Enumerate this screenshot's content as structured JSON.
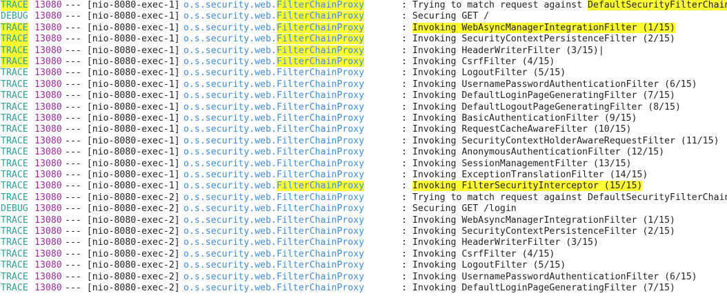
{
  "colors": {
    "trace": "#2aa198",
    "debug": "#2aa198",
    "pid": "#a626a4",
    "logger": "#3b8ede",
    "text": "#222222",
    "highlight": "#ffff33"
  },
  "rows": [
    {
      "level": "TRACE",
      "pid": "13080",
      "thread": "--- [nio-8080-exec-1]",
      "logger_prefix": "o.s.security.web.",
      "logger_class": "FilterChainProxy",
      "msg_prefix": ": ",
      "message": "Trying to match request against ",
      "message_tail": "DefaultSecurityFilterChain [",
      "hl_level": true,
      "hl_logger": true,
      "hl_msg": false,
      "hl_tail": true
    },
    {
      "level": "DEBUG",
      "pid": "13080",
      "thread": "--- [nio-8080-exec-1]",
      "logger_prefix": "o.s.security.web.",
      "logger_class": "FilterChainProxy",
      "msg_prefix": ": ",
      "message": "Securing GET /",
      "message_tail": "",
      "hl_level": false,
      "hl_logger": true,
      "hl_msg": false,
      "hl_tail": false
    },
    {
      "level": "TRACE",
      "pid": "13080",
      "thread": "--- [nio-8080-exec-1]",
      "logger_prefix": "o.s.security.web.",
      "logger_class": "FilterChainProxy",
      "msg_prefix": ": ",
      "message": "Invoking WebAsyncManagerIntegrationFilter (1/15)",
      "message_tail": "",
      "hl_level": true,
      "hl_logger": true,
      "hl_msg": true,
      "hl_tail": false
    },
    {
      "level": "TRACE",
      "pid": "13080",
      "thread": "--- [nio-8080-exec-1]",
      "logger_prefix": "o.s.security.web.",
      "logger_class": "FilterChainProxy",
      "msg_prefix": ": ",
      "message": "Invoking SecurityContextPersistenceFilter (2/15)",
      "message_tail": "",
      "hl_level": true,
      "hl_logger": true,
      "hl_msg": false,
      "hl_tail": false
    },
    {
      "level": "TRACE",
      "pid": "13080",
      "thread": "--- [nio-8080-exec-1]",
      "logger_prefix": "o.s.security.web.",
      "logger_class": "FilterChainProxy",
      "msg_prefix": ": ",
      "message": "Invoking HeaderWriterFilter (3/15)",
      "message_tail": "|",
      "hl_level": true,
      "hl_logger": true,
      "hl_msg": false,
      "hl_tail": false
    },
    {
      "level": "TRACE",
      "pid": "13080",
      "thread": "--- [nio-8080-exec-1]",
      "logger_prefix": "o.s.security.web.",
      "logger_class": "FilterChainProxy",
      "msg_prefix": ": ",
      "message": "Invoking CsrfFilter (4/15)",
      "message_tail": "",
      "hl_level": true,
      "hl_logger": true,
      "hl_msg": false,
      "hl_tail": false
    },
    {
      "level": "TRACE",
      "pid": "13080",
      "thread": "--- [nio-8080-exec-1]",
      "logger_prefix": "o.s.security.web.",
      "logger_class": "FilterChainProxy",
      "msg_prefix": ": ",
      "message": "Invoking LogoutFilter (5/15)",
      "message_tail": "",
      "hl_level": false,
      "hl_logger": false,
      "hl_msg": false,
      "hl_tail": false
    },
    {
      "level": "TRACE",
      "pid": "13080",
      "thread": "--- [nio-8080-exec-1]",
      "logger_prefix": "o.s.security.web.",
      "logger_class": "FilterChainProxy",
      "msg_prefix": ": ",
      "message": "Invoking UsernamePasswordAuthenticationFilter (6/15)",
      "message_tail": "",
      "hl_level": false,
      "hl_logger": false,
      "hl_msg": false,
      "hl_tail": false
    },
    {
      "level": "TRACE",
      "pid": "13080",
      "thread": "--- [nio-8080-exec-1]",
      "logger_prefix": "o.s.security.web.",
      "logger_class": "FilterChainProxy",
      "msg_prefix": ": ",
      "message": "Invoking DefaultLoginPageGeneratingFilter (7/15)",
      "message_tail": "",
      "hl_level": false,
      "hl_logger": false,
      "hl_msg": false,
      "hl_tail": false
    },
    {
      "level": "TRACE",
      "pid": "13080",
      "thread": "--- [nio-8080-exec-1]",
      "logger_prefix": "o.s.security.web.",
      "logger_class": "FilterChainProxy",
      "msg_prefix": ": ",
      "message": "Invoking DefaultLogoutPageGeneratingFilter (8/15)",
      "message_tail": "",
      "hl_level": false,
      "hl_logger": false,
      "hl_msg": false,
      "hl_tail": false
    },
    {
      "level": "TRACE",
      "pid": "13080",
      "thread": "--- [nio-8080-exec-1]",
      "logger_prefix": "o.s.security.web.",
      "logger_class": "FilterChainProxy",
      "msg_prefix": ": ",
      "message": "Invoking BasicAuthenticationFilter (9/15)",
      "message_tail": "",
      "hl_level": false,
      "hl_logger": false,
      "hl_msg": false,
      "hl_tail": false
    },
    {
      "level": "TRACE",
      "pid": "13080",
      "thread": "--- [nio-8080-exec-1]",
      "logger_prefix": "o.s.security.web.",
      "logger_class": "FilterChainProxy",
      "msg_prefix": ": ",
      "message": "Invoking RequestCacheAwareFilter (10/15)",
      "message_tail": "",
      "hl_level": false,
      "hl_logger": false,
      "hl_msg": false,
      "hl_tail": false
    },
    {
      "level": "TRACE",
      "pid": "13080",
      "thread": "--- [nio-8080-exec-1]",
      "logger_prefix": "o.s.security.web.",
      "logger_class": "FilterChainProxy",
      "msg_prefix": ": ",
      "message": "Invoking SecurityContextHolderAwareRequestFilter (11/15)",
      "message_tail": "",
      "hl_level": false,
      "hl_logger": false,
      "hl_msg": false,
      "hl_tail": false
    },
    {
      "level": "TRACE",
      "pid": "13080",
      "thread": "--- [nio-8080-exec-1]",
      "logger_prefix": "o.s.security.web.",
      "logger_class": "FilterChainProxy",
      "msg_prefix": ": ",
      "message": "Invoking AnonymousAuthenticationFilter (12/15)",
      "message_tail": "",
      "hl_level": false,
      "hl_logger": false,
      "hl_msg": false,
      "hl_tail": false
    },
    {
      "level": "TRACE",
      "pid": "13080",
      "thread": "--- [nio-8080-exec-1]",
      "logger_prefix": "o.s.security.web.",
      "logger_class": "FilterChainProxy",
      "msg_prefix": ": ",
      "message": "Invoking SessionManagementFilter (13/15)",
      "message_tail": "",
      "hl_level": false,
      "hl_logger": false,
      "hl_msg": false,
      "hl_tail": false
    },
    {
      "level": "TRACE",
      "pid": "13080",
      "thread": "--- [nio-8080-exec-1]",
      "logger_prefix": "o.s.security.web.",
      "logger_class": "FilterChainProxy",
      "msg_prefix": ": ",
      "message": "Invoking ExceptionTranslationFilter (14/15)",
      "message_tail": "",
      "hl_level": false,
      "hl_logger": false,
      "hl_msg": false,
      "hl_tail": false
    },
    {
      "level": "TRACE",
      "pid": "13080",
      "thread": "--- [nio-8080-exec-1]",
      "logger_prefix": "o.s.security.web.",
      "logger_class": "FilterChainProxy",
      "msg_prefix": ": ",
      "message": "Invoking FilterSecurityInterceptor (15/15)",
      "message_tail": "",
      "hl_level": false,
      "hl_logger": true,
      "hl_msg": true,
      "hl_tail": false
    },
    {
      "level": "TRACE",
      "pid": "13080",
      "thread": "--- [nio-8080-exec-2]",
      "logger_prefix": "o.s.security.web.",
      "logger_class": "FilterChainProxy",
      "msg_prefix": ": ",
      "message": "Trying to match request against DefaultSecurityFilterChain [",
      "message_tail": "",
      "hl_level": false,
      "hl_logger": false,
      "hl_msg": false,
      "hl_tail": false
    },
    {
      "level": "DEBUG",
      "pid": "13080",
      "thread": "--- [nio-8080-exec-2]",
      "logger_prefix": "o.s.security.web.",
      "logger_class": "FilterChainProxy",
      "msg_prefix": ": ",
      "message": "Securing GET /login",
      "message_tail": "",
      "hl_level": false,
      "hl_logger": false,
      "hl_msg": false,
      "hl_tail": false
    },
    {
      "level": "TRACE",
      "pid": "13080",
      "thread": "--- [nio-8080-exec-2]",
      "logger_prefix": "o.s.security.web.",
      "logger_class": "FilterChainProxy",
      "msg_prefix": ": ",
      "message": "Invoking WebAsyncManagerIntegrationFilter (1/15)",
      "message_tail": "",
      "hl_level": false,
      "hl_logger": false,
      "hl_msg": false,
      "hl_tail": false
    },
    {
      "level": "TRACE",
      "pid": "13080",
      "thread": "--- [nio-8080-exec-2]",
      "logger_prefix": "o.s.security.web.",
      "logger_class": "FilterChainProxy",
      "msg_prefix": ": ",
      "message": "Invoking SecurityContextPersistenceFilter (2/15)",
      "message_tail": "",
      "hl_level": false,
      "hl_logger": false,
      "hl_msg": false,
      "hl_tail": false
    },
    {
      "level": "TRACE",
      "pid": "13080",
      "thread": "--- [nio-8080-exec-2]",
      "logger_prefix": "o.s.security.web.",
      "logger_class": "FilterChainProxy",
      "msg_prefix": ": ",
      "message": "Invoking HeaderWriterFilter (3/15)",
      "message_tail": "",
      "hl_level": false,
      "hl_logger": false,
      "hl_msg": false,
      "hl_tail": false
    },
    {
      "level": "TRACE",
      "pid": "13080",
      "thread": "--- [nio-8080-exec-2]",
      "logger_prefix": "o.s.security.web.",
      "logger_class": "FilterChainProxy",
      "msg_prefix": ": ",
      "message": "Invoking CsrfFilter (4/15)",
      "message_tail": "",
      "hl_level": false,
      "hl_logger": false,
      "hl_msg": false,
      "hl_tail": false
    },
    {
      "level": "TRACE",
      "pid": "13080",
      "thread": "--- [nio-8080-exec-2]",
      "logger_prefix": "o.s.security.web.",
      "logger_class": "FilterChainProxy",
      "msg_prefix": ": ",
      "message": "Invoking LogoutFilter (5/15)",
      "message_tail": "",
      "hl_level": false,
      "hl_logger": false,
      "hl_msg": false,
      "hl_tail": false
    },
    {
      "level": "TRACE",
      "pid": "13080",
      "thread": "--- [nio-8080-exec-2]",
      "logger_prefix": "o.s.security.web.",
      "logger_class": "FilterChainProxy",
      "msg_prefix": ": ",
      "message": "Invoking UsernamePasswordAuthenticationFilter (6/15)",
      "message_tail": "",
      "hl_level": false,
      "hl_logger": false,
      "hl_msg": false,
      "hl_tail": false
    },
    {
      "level": "TRACE",
      "pid": "13080",
      "thread": "--- [nio-8080-exec-2]",
      "logger_prefix": "o.s.security.web.",
      "logger_class": "FilterChainProxy",
      "msg_prefix": ": ",
      "message": "Invoking DefaultLoginPageGeneratingFilter (7/15)",
      "message_tail": "",
      "hl_level": false,
      "hl_logger": false,
      "hl_msg": false,
      "hl_tail": false
    }
  ]
}
